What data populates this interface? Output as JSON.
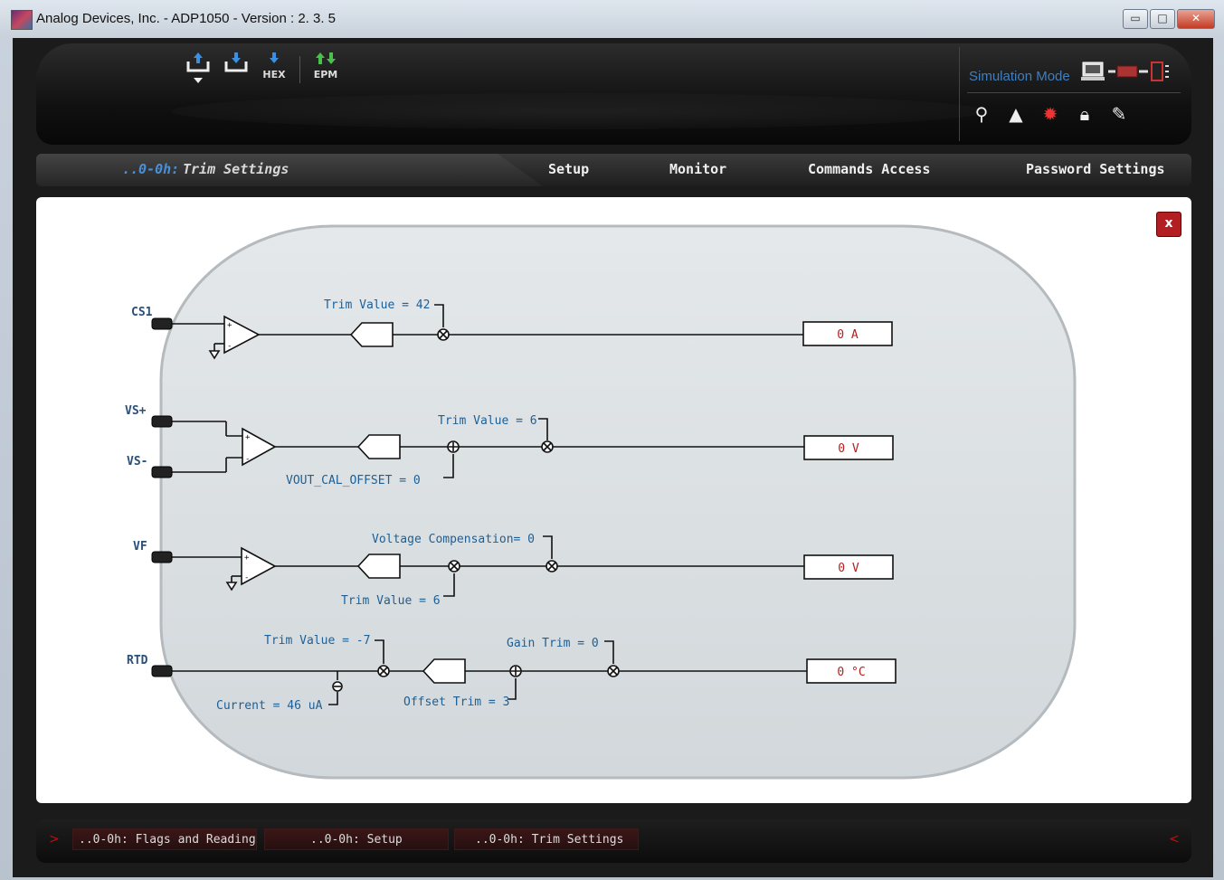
{
  "window": {
    "title": "Analog Devices, Inc. - ADP1050 - Version :  2. 3. 5",
    "minimize_glyph": "▭",
    "maximize_glyph": "□",
    "close_glyph": "✕"
  },
  "toolbar": {
    "icons": [
      "download-icon",
      "upload-icon",
      "hex-icon",
      "epm-icon"
    ],
    "hex_label": "HEX",
    "epm_label": "EPM",
    "simulation_mode": "Simulation Mode",
    "right_icons": [
      "search-icon",
      "waveform-icon",
      "bug-icon",
      "lock-icon",
      "pencil-icon"
    ]
  },
  "nav": {
    "crumb_prefix": "..0-0h:",
    "crumb_title": "Trim Settings",
    "tabs": [
      "Setup",
      "Monitor",
      "Commands Access",
      "Password Settings"
    ]
  },
  "content": {
    "close_label": "x"
  },
  "diagram": {
    "inputs": {
      "cs1": "CS1",
      "vs_plus": "VS+",
      "vs_minus": "VS-",
      "vf": "VF",
      "rtd": "RTD"
    },
    "labels": {
      "cs1_trim": "Trim Value = 42",
      "vs_trim": "Trim Value = 6",
      "vout_offset": "VOUT_CAL_OFFSET = 0",
      "vf_comp": "Voltage Compensation= 0",
      "vf_trim": "Trim Value = 6",
      "rtd_trim": "Trim Value = -7",
      "rtd_gain": "Gain Trim = 0",
      "rtd_current": "Current = 46 uA",
      "rtd_offset": "Offset Trim = 3"
    },
    "outputs": {
      "cs1": "0 A",
      "vs": "0 V",
      "vf": "0 V",
      "rtd": "0 °C"
    }
  },
  "statusbar": {
    "tabs": [
      "..0-0h: Flags and Readings",
      "..0-0h: Setup",
      "..0-0h: Trim Settings"
    ],
    "left_arrow": ">",
    "right_arrow": "<"
  }
}
